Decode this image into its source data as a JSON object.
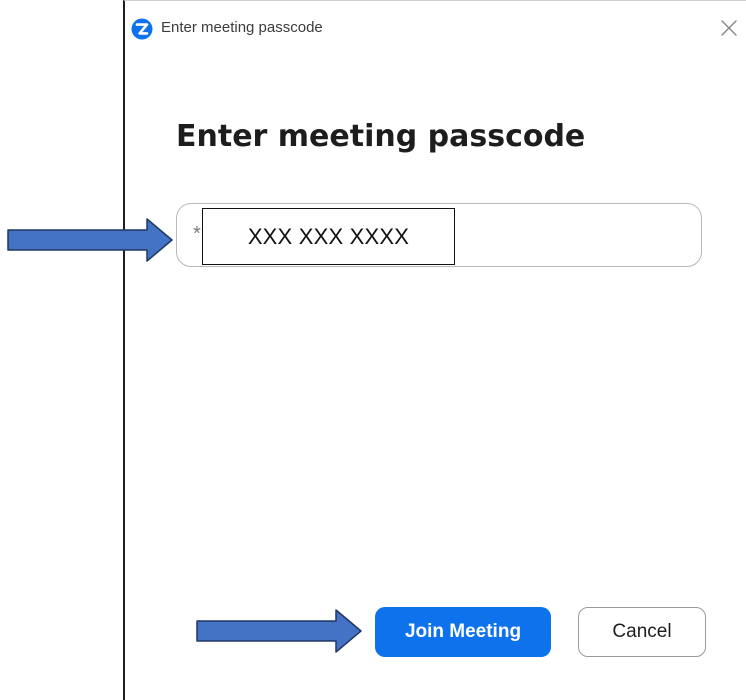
{
  "window": {
    "title": "Enter meeting passcode"
  },
  "dialog": {
    "heading": "Enter meeting passcode",
    "passcode_field": {
      "prefix": "*",
      "value": "XXX XXX XXXX"
    },
    "join_label": "Join Meeting",
    "cancel_label": "Cancel"
  },
  "icons": {
    "app_logo": "zoom-logo-icon",
    "close": "close-icon",
    "callout_arrow_field": "arrow-right-icon",
    "callout_arrow_button": "arrow-right-icon"
  },
  "colors": {
    "accent": "#0e72ed",
    "arrow_fill": "#4472c4",
    "arrow_stroke": "#1f3864",
    "field_border": "#b8b8b8"
  }
}
